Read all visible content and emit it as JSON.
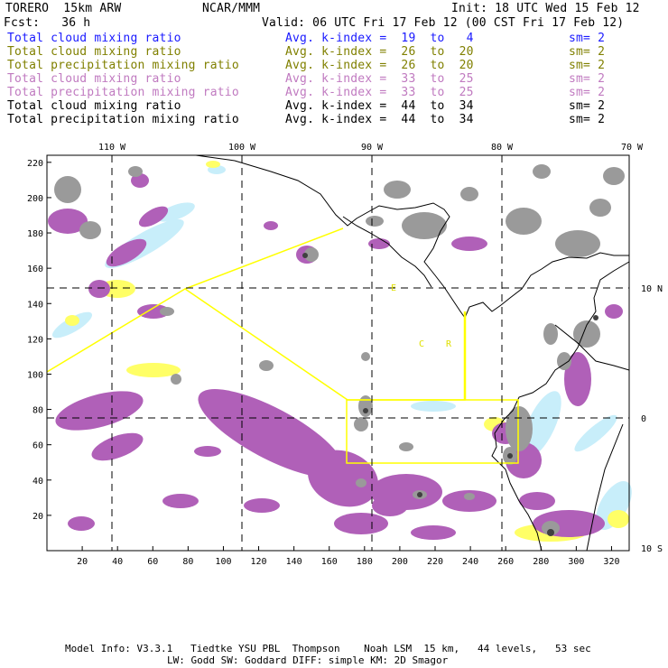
{
  "header": {
    "model": "TORERO  15km ARW",
    "org": "NCAR/MMM",
    "init": "Init: 18 UTC Wed 15 Feb 12",
    "fcst": "Fcst:   36 h",
    "valid": "Valid: 06 UTC Fri 17 Feb 12 (00 CST Fri 17 Feb 12)"
  },
  "fields": [
    {
      "name": "Total cloud mixing ratio",
      "kindex": "Avg. k-index =  19  to   4",
      "sm": "sm= 2",
      "color": "#1a1aff"
    },
    {
      "name": "Total cloud mixing ratio",
      "kindex": "Avg. k-index =  26  to  20",
      "sm": "sm= 2",
      "color": "#808000"
    },
    {
      "name": "Total precipitation mixing ratio",
      "kindex": "Avg. k-index =  26  to  20",
      "sm": "sm= 2",
      "color": "#808000"
    },
    {
      "name": "Total cloud mixing ratio",
      "kindex": "Avg. k-index =  33  to  25",
      "sm": "sm= 2",
      "color": "#c07ac0"
    },
    {
      "name": "Total precipitation mixing ratio",
      "kindex": "Avg. k-index =  33  to  25",
      "sm": "sm= 2",
      "color": "#c07ac0"
    },
    {
      "name": "Total cloud mixing ratio",
      "kindex": "Avg. k-index =  44  to  34",
      "sm": "sm= 2",
      "color": "#000000"
    },
    {
      "name": "Total precipitation mixing ratio",
      "kindex": "Avg. k-index =  44  to  34",
      "sm": "sm= 2",
      "color": "#000000"
    }
  ],
  "chart_data": {
    "type": "heatmap",
    "x_ticks": [
      20,
      40,
      60,
      80,
      100,
      120,
      140,
      160,
      180,
      200,
      220,
      240,
      260,
      280,
      300,
      320
    ],
    "y_ticks": [
      20,
      40,
      60,
      80,
      100,
      120,
      140,
      160,
      180,
      200,
      220
    ],
    "xlim": [
      0,
      330
    ],
    "ylim": [
      0,
      224
    ],
    "lon_labels": [
      "110 W",
      "100 W",
      "90 W",
      "80 W",
      "70 W"
    ],
    "lat_labels": [
      "10 N",
      "0",
      "10 S"
    ],
    "map_labels": [
      "E",
      "C",
      "R"
    ],
    "colors": {
      "light_blue": "#c8eefa",
      "yellow": "#ffff66",
      "purple": "#b060b8",
      "gray": "#9a9a9a",
      "dark": "#404040",
      "grid": "#000000",
      "box": "#ffff00"
    }
  },
  "footer": {
    "line1": "Model Info: V3.3.1   Tiedtke YSU PBL  Thompson    Noah LSM  15 km,   44 levels,   53 sec",
    "line2": "LW: Godd SW: Goddard DIFF: simple KM: 2D Smagor"
  }
}
